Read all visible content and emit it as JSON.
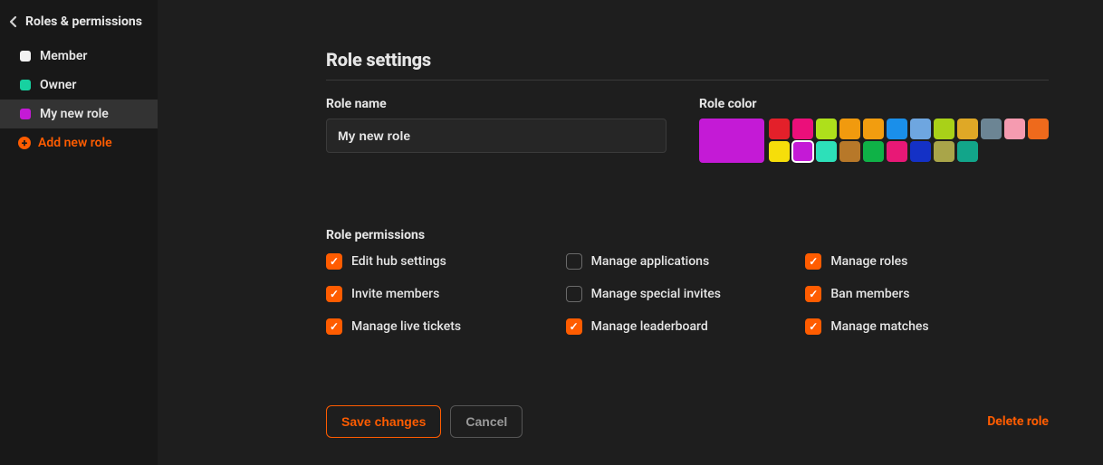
{
  "sidebar": {
    "title": "Roles & permissions",
    "roles": [
      {
        "label": "Member",
        "color": "#f2f2f2",
        "active": false
      },
      {
        "label": "Owner",
        "color": "#17d1a0",
        "active": false
      },
      {
        "label": "My new role",
        "color": "#c41ad6",
        "active": true
      }
    ],
    "add_label": "Add new role"
  },
  "main": {
    "title": "Role settings",
    "role_name_label": "Role name",
    "role_name_value": "My new role",
    "role_color_label": "Role color",
    "selected_color": "#c41ad6",
    "color_rows": [
      [
        "#e3202a",
        "#eb0f7a",
        "#aee01b",
        "#f19a0e",
        "#f29d0f",
        "#1a8fea",
        "#6ea6e0",
        "#a9d118",
        "#dfa826",
        "#6c8594",
        "#f59bb0",
        "#ee6a1c"
      ],
      [
        "#f6de0a",
        "#c41ad6",
        "#2de0b9",
        "#b77829",
        "#0fb247",
        "#e81876",
        "#1431c6",
        "#a9a549",
        "#12a58a"
      ]
    ],
    "selected_swatch_index": [
      1,
      1
    ],
    "permissions_label": "Role permissions",
    "permissions": [
      {
        "label": "Edit hub settings",
        "checked": true
      },
      {
        "label": "Manage applications",
        "checked": false
      },
      {
        "label": "Manage roles",
        "checked": true
      },
      {
        "label": "Invite members",
        "checked": true
      },
      {
        "label": "Manage special invites",
        "checked": false
      },
      {
        "label": "Ban members",
        "checked": true
      },
      {
        "label": "Manage live tickets",
        "checked": true
      },
      {
        "label": "Manage leaderboard",
        "checked": true
      },
      {
        "label": "Manage matches",
        "checked": true
      }
    ],
    "save_label": "Save changes",
    "cancel_label": "Cancel",
    "delete_label": "Delete role"
  }
}
